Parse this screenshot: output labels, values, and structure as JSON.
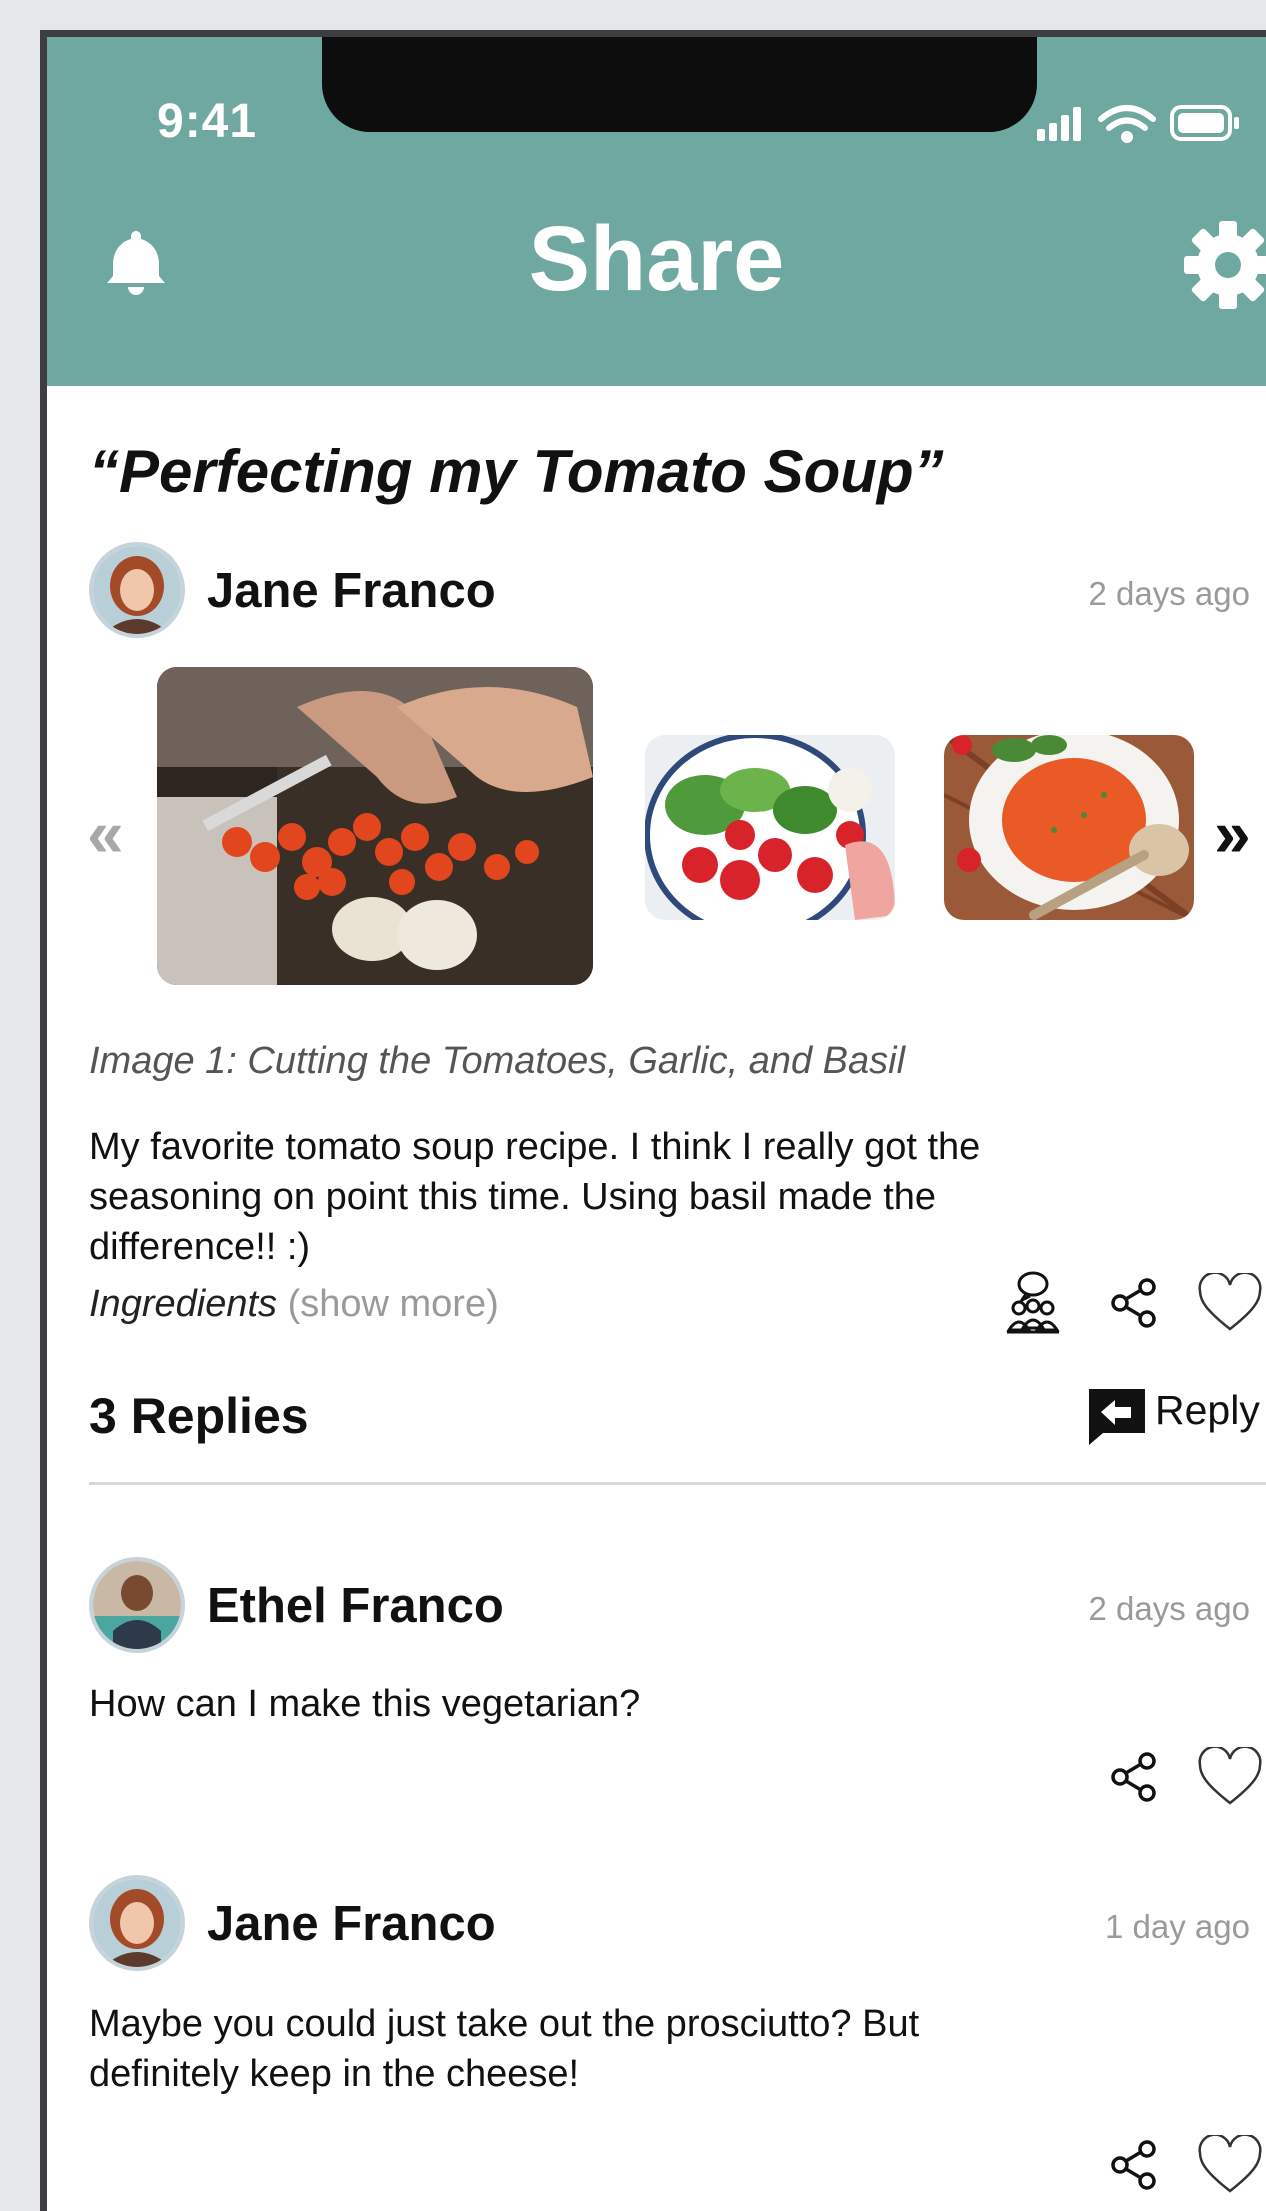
{
  "status_bar": {
    "time": "9:41"
  },
  "header": {
    "title": "Share",
    "bell_icon": "bell-icon",
    "settings_icon": "gear-icon"
  },
  "post": {
    "title": "“Perfecting my Tomato Soup”",
    "author": "Jane Franco",
    "time_ago": "2 days ago",
    "carousel": {
      "prev_label": "«",
      "next_label": "»",
      "images": [
        "Cutting tomatoes, garlic and basil",
        "Tomato and basil salad",
        "Tomato soup in a bowl"
      ]
    },
    "caption": "Image 1: Cutting the Tomatoes, Garlic, and Basil",
    "body": {
      "line1": "My favorite tomato soup recipe. I think I really got the",
      "line2": "seasoning on point this time. Using basil made the",
      "line3": "difference!! :)"
    },
    "ingredients_label": "Ingredients",
    "show_more_label": "(show more)"
  },
  "replies": {
    "title": "3 Replies",
    "reply_label": "Reply",
    "items": [
      {
        "author": "Ethel Franco",
        "time_ago": "2 days ago",
        "text": "How can I make this vegetarian?"
      },
      {
        "author": "Jane Franco",
        "time_ago": "1 day ago",
        "line1": "Maybe you could just take out the prosciutto? But",
        "line2": "definitely keep in the cheese!"
      }
    ]
  },
  "colors": {
    "header": "#6fa8a1",
    "text": "#111111",
    "muted": "#9a9a9a"
  }
}
